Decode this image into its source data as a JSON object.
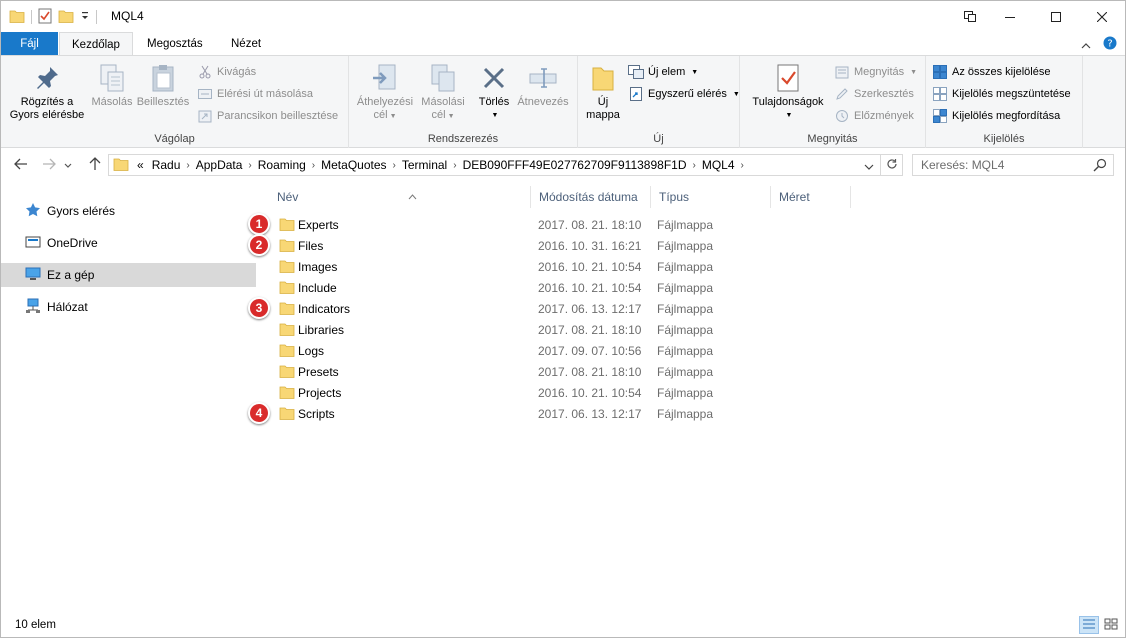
{
  "window": {
    "title": "MQL4"
  },
  "ribbon_tabs": [
    "Fájl",
    "Kezdőlap",
    "Megosztás",
    "Nézet"
  ],
  "ribbon": {
    "clipboard": {
      "label": "Vágólap",
      "pin": [
        "Rögzítés a",
        "Gyors elérésbe"
      ],
      "copy": "Másolás",
      "paste": "Beillesztés",
      "cut": "Kivágás",
      "copy_path": "Elérési út másolása",
      "paste_shortcut": "Parancsikon beillesztése"
    },
    "organize": {
      "label": "Rendszerezés",
      "move_to": [
        "Áthelyezési",
        "cél"
      ],
      "copy_to": [
        "Másolási",
        "cél"
      ],
      "delete": "Törlés",
      "rename": "Átnevezés"
    },
    "new": {
      "label": "Új",
      "new_folder": [
        "Új",
        "mappa"
      ],
      "new_item": "Új elem",
      "easy_access": "Egyszerű elérés"
    },
    "open": {
      "label": "Megnyitás",
      "properties": "Tulajdonságok",
      "open": "Megnyitás",
      "edit": "Szerkesztés",
      "history": "Előzmények"
    },
    "select": {
      "label": "Kijelölés",
      "select_all": "Az összes kijelölése",
      "select_none": "Kijelölés megszüntetése",
      "invert": "Kijelölés megfordítása"
    }
  },
  "address": {
    "overflow": "«",
    "crumbs": [
      "Radu",
      "AppData",
      "Roaming",
      "MetaQuotes",
      "Terminal",
      "DEB090FFF49E027762709F9113898F1D",
      "MQL4"
    ]
  },
  "search": {
    "placeholder": "Keresés: MQL4"
  },
  "nav": [
    "Gyors elérés",
    "OneDrive",
    "Ez a gép",
    "Hálózat"
  ],
  "columns": [
    "Név",
    "Módosítás dátuma",
    "Típus",
    "Méret"
  ],
  "files": [
    {
      "name": "Experts",
      "date": "2017. 08. 21. 18:10",
      "type": "Fájlmappa",
      "badge": "1"
    },
    {
      "name": "Files",
      "date": "2016. 10. 31. 16:21",
      "type": "Fájlmappa",
      "badge": "2"
    },
    {
      "name": "Images",
      "date": "2016. 10. 21. 10:54",
      "type": "Fájlmappa",
      "badge": ""
    },
    {
      "name": "Include",
      "date": "2016. 10. 21. 10:54",
      "type": "Fájlmappa",
      "badge": ""
    },
    {
      "name": "Indicators",
      "date": "2017. 06. 13. 12:17",
      "type": "Fájlmappa",
      "badge": "3"
    },
    {
      "name": "Libraries",
      "date": "2017. 08. 21. 18:10",
      "type": "Fájlmappa",
      "badge": ""
    },
    {
      "name": "Logs",
      "date": "2017. 09. 07. 10:56",
      "type": "Fájlmappa",
      "badge": ""
    },
    {
      "name": "Presets",
      "date": "2017. 08. 21. 18:10",
      "type": "Fájlmappa",
      "badge": ""
    },
    {
      "name": "Projects",
      "date": "2016. 10. 21. 10:54",
      "type": "Fájlmappa",
      "badge": ""
    },
    {
      "name": "Scripts",
      "date": "2017. 06. 13. 12:17",
      "type": "Fájlmappa",
      "badge": "4"
    }
  ],
  "status": {
    "count": "10 elem"
  },
  "colors": {
    "file_tab": "#1979ca",
    "folder": "#f8d775",
    "badge": "#d92b2b",
    "selected_nav": "#d9d9d9"
  }
}
